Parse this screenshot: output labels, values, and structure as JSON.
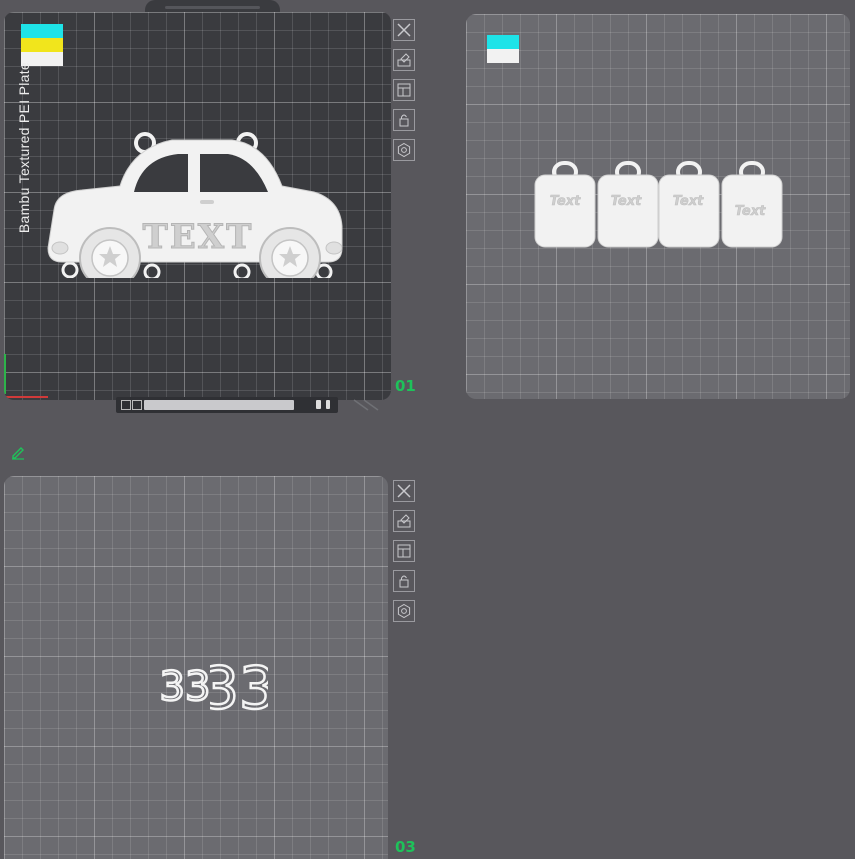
{
  "plates": [
    {
      "id": "plate-1",
      "number": "01",
      "selected": true,
      "label": "Bambu Textured PEI Plate",
      "filament_colors": [
        "#1ee3e8",
        "#f1e51c",
        "#f2f2f2"
      ],
      "objects": [
        {
          "name": "car-plate",
          "text": "TEXT"
        }
      ]
    },
    {
      "id": "plate-2",
      "number": "",
      "selected": false,
      "filament_colors": [
        "#1ee3e8",
        "#f2f2f2"
      ],
      "objects": [
        {
          "name": "keychain-tag-1",
          "text": "Text"
        },
        {
          "name": "keychain-tag-2",
          "text": "Text"
        },
        {
          "name": "keychain-tag-3",
          "text": "Text"
        },
        {
          "name": "keychain-tag-4",
          "text": "Text"
        }
      ]
    },
    {
      "id": "plate-3",
      "number": "03",
      "selected": false,
      "filament_colors": [],
      "objects": [
        {
          "name": "number-33-small",
          "text": "33"
        },
        {
          "name": "number-33-large",
          "text": "33"
        }
      ]
    }
  ],
  "toolbar_icons": [
    "close-icon",
    "auto-orient-icon",
    "arrange-icon",
    "lock-icon",
    "settings-icon"
  ],
  "colors": {
    "background": "#58575c",
    "plate_selected": "#3a3b3f",
    "plate": "#6b6b70",
    "plate_number": "#1ec25a",
    "model": "#f2f2f2"
  }
}
